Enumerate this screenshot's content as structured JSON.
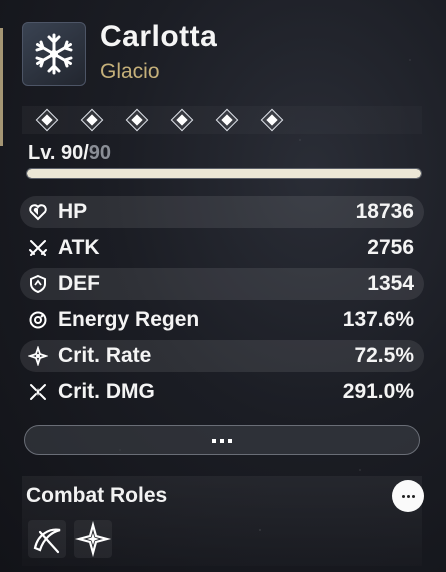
{
  "character": {
    "name": "Carlotta",
    "element": "Glacio",
    "element_icon": "snowflake-icon"
  },
  "sequence": {
    "nodes": [
      "sequence-node-1",
      "sequence-node-2",
      "sequence-node-3",
      "sequence-node-4",
      "sequence-node-5",
      "sequence-node-6"
    ]
  },
  "level": {
    "label": "Lv. 90/",
    "max": "90",
    "progress": 1.0
  },
  "stats": [
    {
      "label": "HP",
      "value": "18736",
      "icon": "heart-icon"
    },
    {
      "label": "ATK",
      "value": "2756",
      "icon": "crossed-swords-icon"
    },
    {
      "label": "DEF",
      "value": "1354",
      "icon": "shield-icon"
    },
    {
      "label": "Energy Regen",
      "value": "137.6%",
      "icon": "energy-regen-icon"
    },
    {
      "label": "Crit. Rate",
      "value": "72.5%",
      "icon": "crit-rate-icon"
    },
    {
      "label": "Crit. DMG",
      "value": "291.0%",
      "icon": "crit-dmg-icon"
    }
  ],
  "combat_roles": {
    "title": "Combat Roles",
    "roles": [
      {
        "icon": "scythe-icon"
      },
      {
        "icon": "sparkle-star-icon"
      }
    ]
  },
  "colors": {
    "accent_gold": "#c5b07a",
    "panel_shade": "rgba(255,255,255,0.09)",
    "text": "#f4f4f4"
  }
}
